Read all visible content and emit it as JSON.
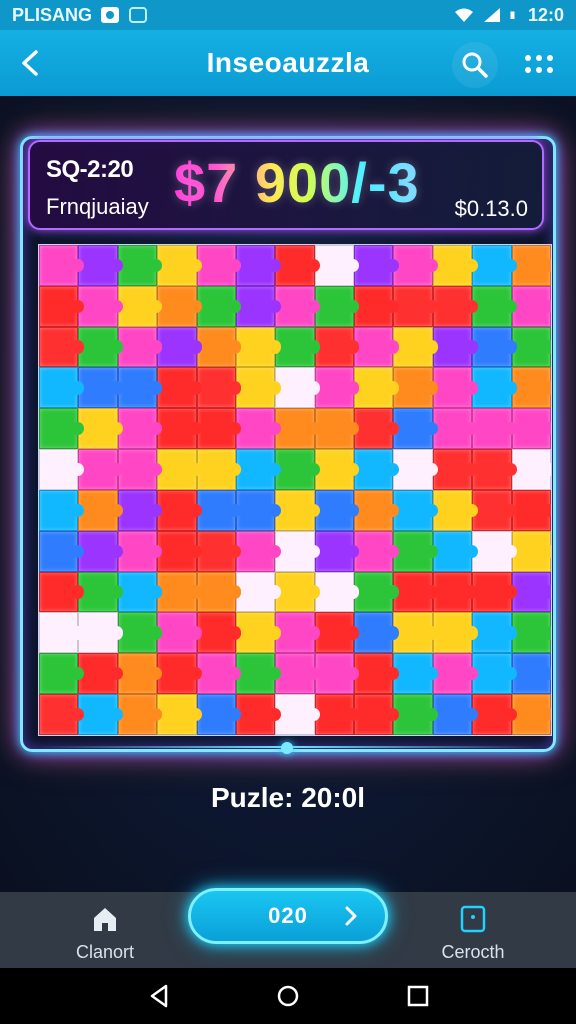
{
  "status_bar": {
    "left_text": "PLISANG",
    "time": "12:0",
    "icons": [
      "app-icon",
      "notification-icon",
      "wifi-icon",
      "signal-icon",
      "battery-icon"
    ]
  },
  "app_bar": {
    "title": "Inseoauzzla",
    "icons": [
      "back-icon",
      "search-icon",
      "more-icon"
    ]
  },
  "hud": {
    "level_text": "SQ-2:20",
    "player_text": "Frnqjuaiay",
    "score_text": "$7 900/-3",
    "coins_text": "$0.13.0"
  },
  "puzzle_label": "Puzle: 20:0l",
  "bottom_nav": {
    "left_label": "Clanort",
    "center_value": "020",
    "right_label": "Cerocth"
  },
  "colors": {
    "accent": "#15b0e3",
    "board_pieces": [
      "#ff2b2b",
      "#2cc53a",
      "#ffd21f",
      "#2f7cff",
      "#ff47c6",
      "#9b34ff",
      "#ff8a1e",
      "#11b7ff",
      "#fff0ff",
      "#ff3030"
    ]
  }
}
